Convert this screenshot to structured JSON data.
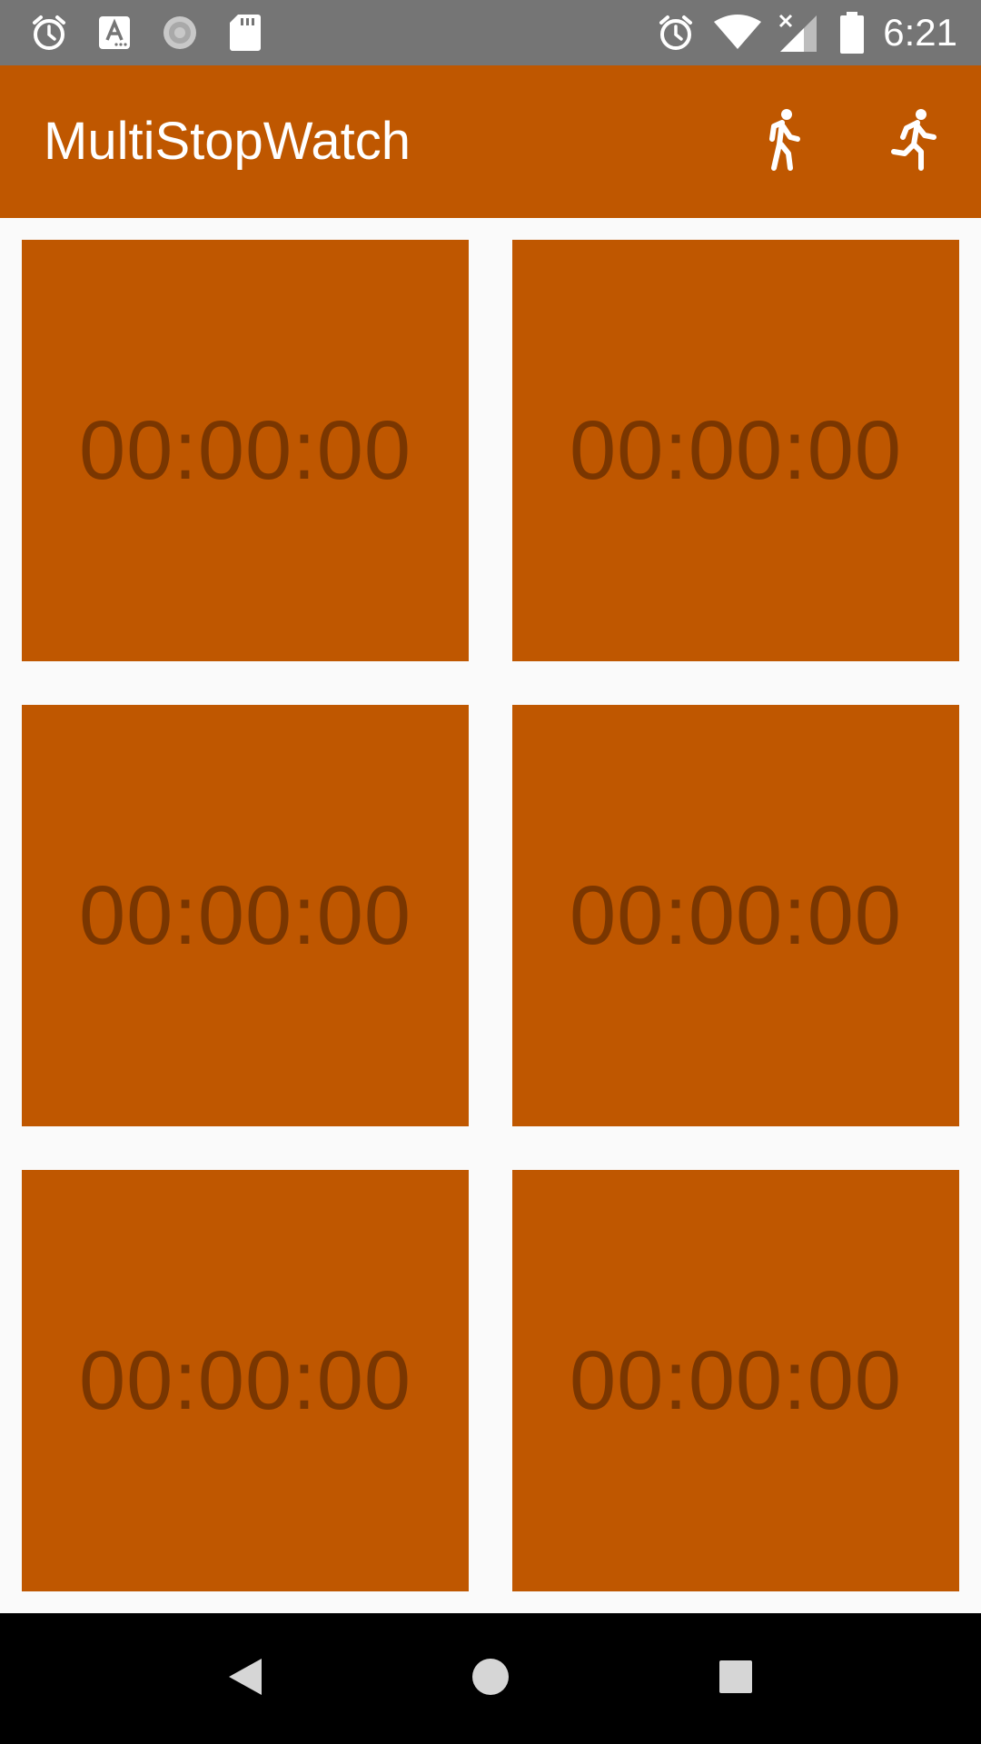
{
  "status_bar": {
    "time": "6:21",
    "left_icons": [
      "alarm-icon",
      "font-a-icon",
      "sync-spinner-icon",
      "sd-card-icon"
    ],
    "right_icons": [
      "alarm-icon",
      "wifi-icon",
      "cell-signal-off-icon",
      "battery-icon"
    ]
  },
  "app_bar": {
    "title": "MultiStopWatch",
    "actions": [
      "walk-icon",
      "run-icon"
    ]
  },
  "stopwatches": [
    {
      "time": "00:00:00"
    },
    {
      "time": "00:00:00"
    },
    {
      "time": "00:00:00"
    },
    {
      "time": "00:00:00"
    },
    {
      "time": "00:00:00"
    },
    {
      "time": "00:00:00"
    }
  ],
  "nav_bar": {
    "buttons": [
      "back-icon",
      "home-icon",
      "recents-icon"
    ]
  },
  "colors": {
    "accent": "#bf5700",
    "tile_text": "#7a3600",
    "status_bar": "#757575",
    "background": "#fafafa",
    "nav_bar": "#000000"
  }
}
